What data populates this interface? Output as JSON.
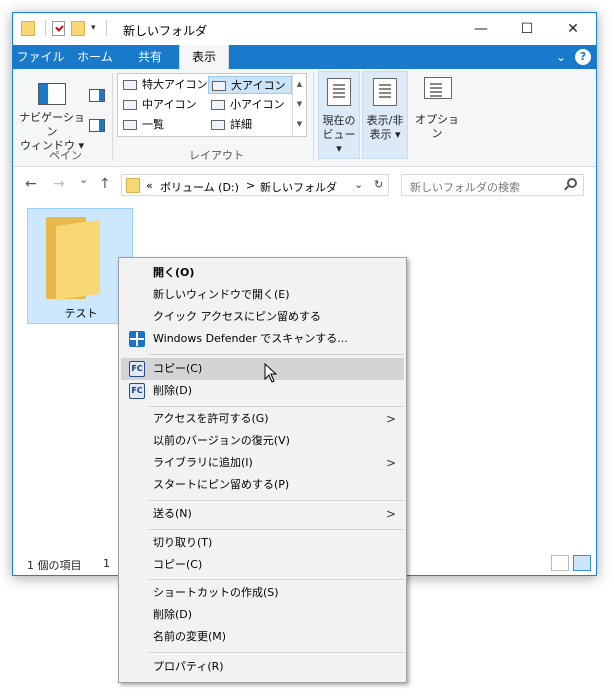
{
  "window": {
    "title": "新しいフォルダ",
    "minimize_symbol": "—",
    "maximize_symbol": "☐",
    "close_symbol": "✕",
    "qat_dropdown_symbol": "▾"
  },
  "tabs": [
    {
      "label": "ファイル"
    },
    {
      "label": "ホーム"
    },
    {
      "label": "共有"
    },
    {
      "label": "表示"
    }
  ],
  "help_label": "?",
  "ribbon": {
    "pane_group": {
      "navigation_pane_line1": "ナビゲーション",
      "navigation_pane_line2": "ウィンドウ ▾",
      "label": "ペイン"
    },
    "layout_group": {
      "items": [
        {
          "label": "特大アイコン"
        },
        {
          "label": "大アイコン"
        },
        {
          "label": "中アイコン"
        },
        {
          "label": "小アイコン"
        },
        {
          "label": "一覧"
        },
        {
          "label": "詳細"
        }
      ],
      "selected": "大アイコン",
      "label": "レイアウト"
    },
    "current_view_line1": "現在の",
    "current_view_line2": "ビュー ▾",
    "show_hide_line1": "表示/非",
    "show_hide_line2": "表示 ▾",
    "options_label": "オプション"
  },
  "nav": {
    "back_symbol": "←",
    "forward_symbol": "→",
    "recent_symbol": "⌄",
    "up_symbol": "↑"
  },
  "address": {
    "overflow": "«",
    "drive": "ボリューム (D:)",
    "separator": ">",
    "folder": "新しいフォルダ",
    "dropdown_symbol": "⌄",
    "refresh_symbol": "↻"
  },
  "search": {
    "placeholder": "新しいフォルダの検索"
  },
  "files": [
    {
      "name": "テスト"
    }
  ],
  "status": {
    "item_count": "1 個の項目",
    "selected_count_partial": "1"
  },
  "context_menu": {
    "group1": [
      {
        "label": "開く(O)"
      },
      {
        "label": "新しいウィンドウで開く(E)"
      },
      {
        "label": "クイック アクセスにピン留めする"
      },
      {
        "label": "Windows Defender でスキャンする..."
      }
    ],
    "group2": [
      {
        "label": "コピー(C)"
      },
      {
        "label": "削除(D)"
      }
    ],
    "group3": [
      {
        "label": "アクセスを許可する(G)"
      },
      {
        "label": "以前のバージョンの復元(V)"
      },
      {
        "label": "ライブラリに追加(I)"
      },
      {
        "label": "スタートにピン留めする(P)"
      }
    ],
    "group4": [
      {
        "label": "送る(N)"
      }
    ],
    "group5": [
      {
        "label": "切り取り(T)"
      },
      {
        "label": "コピー(C)"
      }
    ],
    "group6": [
      {
        "label": "ショートカットの作成(S)"
      },
      {
        "label": "削除(D)"
      },
      {
        "label": "名前の変更(M)"
      }
    ],
    "group7": [
      {
        "label": "プロパティ(R)"
      }
    ],
    "fc_badge": "FC",
    "submenu_arrow": ">"
  }
}
